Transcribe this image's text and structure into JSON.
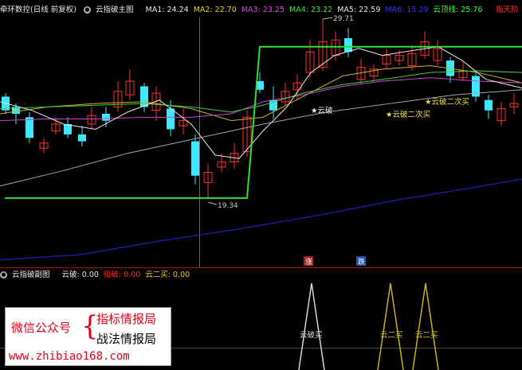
{
  "main_header": {
    "stock_name": "牵环数控(日线 前复权)",
    "indicator_name": "云指破主图",
    "ma": [
      {
        "label": "MA1:",
        "value": "24.24",
        "color": "#e8e8e8"
      },
      {
        "label": "MA2:",
        "value": "22.70",
        "color": "#e8d020"
      },
      {
        "label": "MA3:",
        "value": "23.25",
        "color": "#e040e0"
      },
      {
        "label": "MA4:",
        "value": "23.22",
        "color": "#40e040"
      },
      {
        "label": "MA5:",
        "value": "22.59",
        "color": "#e8e8e8"
      },
      {
        "label": "MA6:",
        "value": "15.29",
        "color": "#3030ff"
      },
      {
        "label": "云顶线:",
        "value": "25.76",
        "color": "#30ff30"
      }
    ],
    "tag": "指天阶"
  },
  "annotations": {
    "high_label": "29.71",
    "low_label": "19.34",
    "buy1": "云破",
    "buy2": "云破二次买",
    "buy3": "云破二次买"
  },
  "bottom_markers": {
    "red": "涨",
    "blue": "跌"
  },
  "sub_header": {
    "indicator_name": "云指破副图",
    "items": [
      {
        "label": "云破:",
        "value": "0.00",
        "color": "#e8e8e8"
      },
      {
        "label": "指破:",
        "value": "0.00",
        "color": "#ff3030"
      },
      {
        "label": "云二买:",
        "value": "0.00",
        "color": "#e8d020"
      }
    ]
  },
  "sub_labels": {
    "peak1": "云破买",
    "peak2": "云二买",
    "peak3": "云二买"
  },
  "ad": {
    "wechat": "微信公众号",
    "line1": "指标情报局",
    "line2": "战法情报局",
    "url": "www.zhibiao168.com"
  },
  "colors": {
    "up": "#ff3030",
    "down": "#40e8ff",
    "ma1": "#e8e8e8",
    "ma2": "#d0b020",
    "ma3": "#d040d0",
    "ma4": "#40d040",
    "ma5": "#a8a8a8",
    "ma6": "#2020c0",
    "cloud": "#30e030"
  }
}
